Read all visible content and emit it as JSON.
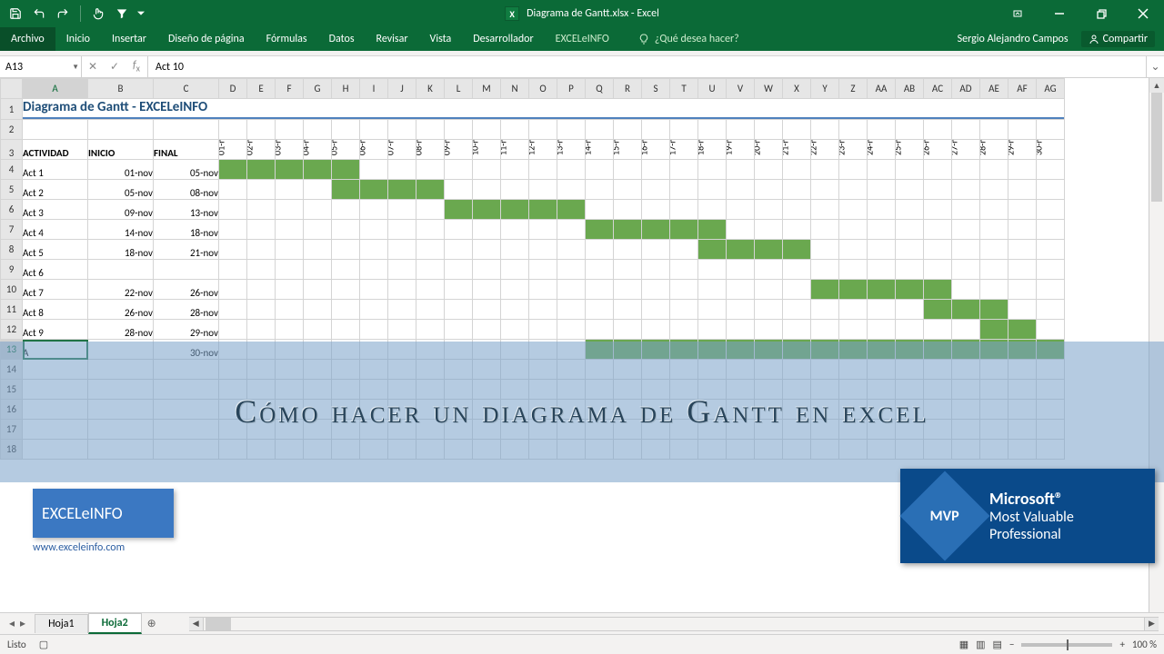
{
  "title": "Diagrama de Gantt.xlsx - Excel",
  "user": "Sergio Alejandro Campos",
  "share": "Compartir",
  "ribbon": {
    "file": "Archivo",
    "tabs": [
      "Inicio",
      "Insertar",
      "Diseño de página",
      "Fórmulas",
      "Datos",
      "Revisar",
      "Vista",
      "Desarrollador"
    ],
    "custom": "EXCELeINFO",
    "tellme": "¿Qué desea hacer?"
  },
  "namebox": "A13",
  "formula": "Act 10",
  "columns": [
    "A",
    "B",
    "C",
    "D",
    "E",
    "F",
    "G",
    "H",
    "I",
    "J",
    "K",
    "L",
    "M",
    "N",
    "O",
    "P",
    "Q",
    "R",
    "S",
    "T",
    "U",
    "V",
    "W",
    "X",
    "Y",
    "Z",
    "AA",
    "AB",
    "AC",
    "AD",
    "AE",
    "AF",
    "AG"
  ],
  "col_widths": {
    "A": 72,
    "B": 72,
    "C": 72,
    "date": 31
  },
  "sheet_title": "Diagrama de Gantt - EXCELeINFO",
  "headers": {
    "activity": "ACTIVIDAD",
    "start": "INICIO",
    "end": "FINAL"
  },
  "date_headers": [
    "01-nov",
    "02-nov",
    "03-nov",
    "04-nov",
    "05-nov",
    "06-nov",
    "07-nov",
    "08-nov",
    "09-nov",
    "10-nov",
    "11-nov",
    "12-nov",
    "13-nov",
    "14-nov",
    "15-nov",
    "16-nov",
    "17-nov",
    "18-nov",
    "19-nov",
    "20-nov",
    "21-nov",
    "22-nov",
    "23-nov",
    "24-nov",
    "25-nov",
    "26-nov",
    "27-nov",
    "28-nov",
    "29-nov",
    "30-nov"
  ],
  "activities": [
    {
      "name": "Act 1",
      "start": "01-nov",
      "end": "05-nov",
      "from": 1,
      "to": 5
    },
    {
      "name": "Act 2",
      "start": "05-nov",
      "end": "08-nov",
      "from": 5,
      "to": 8
    },
    {
      "name": "Act 3",
      "start": "09-nov",
      "end": "13-nov",
      "from": 9,
      "to": 13
    },
    {
      "name": "Act 4",
      "start": "14-nov",
      "end": "18-nov",
      "from": 14,
      "to": 18
    },
    {
      "name": "Act 5",
      "start": "18-nov",
      "end": "21-nov",
      "from": 18,
      "to": 21
    },
    {
      "name": "Act 6",
      "start": "",
      "end": "",
      "from": 0,
      "to": 0
    },
    {
      "name": "Act 7",
      "start": "22-nov",
      "end": "26-nov",
      "from": 22,
      "to": 26
    },
    {
      "name": "Act 8",
      "start": "26-nov",
      "end": "28-nov",
      "from": 26,
      "to": 28
    },
    {
      "name": "Act 9",
      "start": "28-nov",
      "end": "29-nov",
      "from": 28,
      "to": 29
    },
    {
      "name": "A",
      "start": "",
      "end": "30-nov",
      "from": 14,
      "to": 30
    }
  ],
  "overlay_text": "Cómo hacer un diagrama de Gantt en excel",
  "badge": {
    "title": "EXCELeINFO",
    "url": "www.exceleinfo.com"
  },
  "mvp": {
    "diamond": "MVP",
    "l1": "Microsoft®",
    "l2a": "Most Valuable",
    "l2b": "Professional"
  },
  "sheets": {
    "s1": "Hoja1",
    "s2": "Hoja2"
  },
  "status": "Listo",
  "zoom": "100 %"
}
